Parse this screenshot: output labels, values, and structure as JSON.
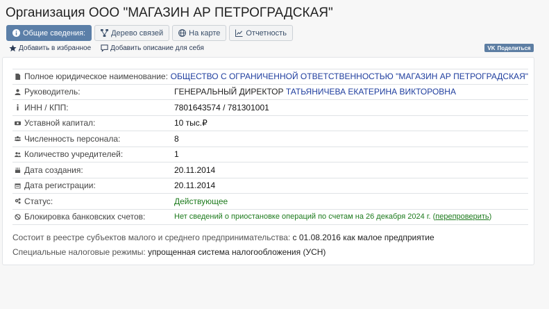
{
  "header": {
    "title": "Организация ООО \"МАГАЗИН АР ПЕТРОГРАДСКАЯ\""
  },
  "tabs": [
    {
      "label": "Общие сведения:",
      "icon": "info-icon",
      "active": true
    },
    {
      "label": "Дерево связей",
      "icon": "sitemap-icon",
      "active": false
    },
    {
      "label": "На карте",
      "icon": "globe-icon",
      "active": false
    },
    {
      "label": "Отчетность",
      "icon": "chart-icon",
      "active": false
    }
  ],
  "actions": {
    "favorite": "Добавить в избранное",
    "description": "Добавить описание для себя",
    "share": "Поделиться"
  },
  "details": [
    {
      "label": "Полное юридическое наименование:",
      "icon": "document-icon",
      "value": "ОБЩЕСТВО С ОГРАНИЧЕННОЙ ОТВЕТСТВЕННОСТЬЮ \"МАГАЗИН АР ПЕТРОГРАДСКАЯ\""
    },
    {
      "label": "Руководитель:",
      "icon": "user-icon",
      "value_prefix": "ГЕНЕРАЛЬНЫЙ ДИРЕКТОР ",
      "value": "ТАТЬЯНИЧЕВА ЕКАТЕРИНА ВИКТОРОВНА"
    },
    {
      "label": "ИНН / КПП:",
      "icon": "info-icon",
      "value": "7801643574 / 781301001"
    },
    {
      "label": "Уставной капитал:",
      "icon": "money-icon",
      "value": "10 тыс.₽"
    },
    {
      "label": "Численность персонала:",
      "icon": "users-icon",
      "value": "8"
    },
    {
      "label": "Количество учредителей:",
      "icon": "users-icon",
      "value": "1"
    },
    {
      "label": "Дата создания:",
      "icon": "birthday-icon",
      "value": "20.11.2014"
    },
    {
      "label": "Дата регистрации:",
      "icon": "calendar-icon",
      "value": "20.11.2014"
    },
    {
      "label": "Статус:",
      "icon": "cogs-icon",
      "value": "Действующее"
    },
    {
      "label": "Блокировка банковских счетов:",
      "icon": "ban-icon",
      "value": "Нет сведений о приостановке операций по счетам на 26 декабря 2024 г. (",
      "link": "перепроверить",
      "value_suffix": ")"
    }
  ],
  "footer": {
    "sme_label": "Состоит в реестре субъектов малого и среднего предпринимательства:",
    "sme_value": " с 01.08.2016 как малое предприятие",
    "tax_label": "Специальные налоговые режимы:",
    "tax_value": " упрощенная система налогообложения (УСН)"
  }
}
